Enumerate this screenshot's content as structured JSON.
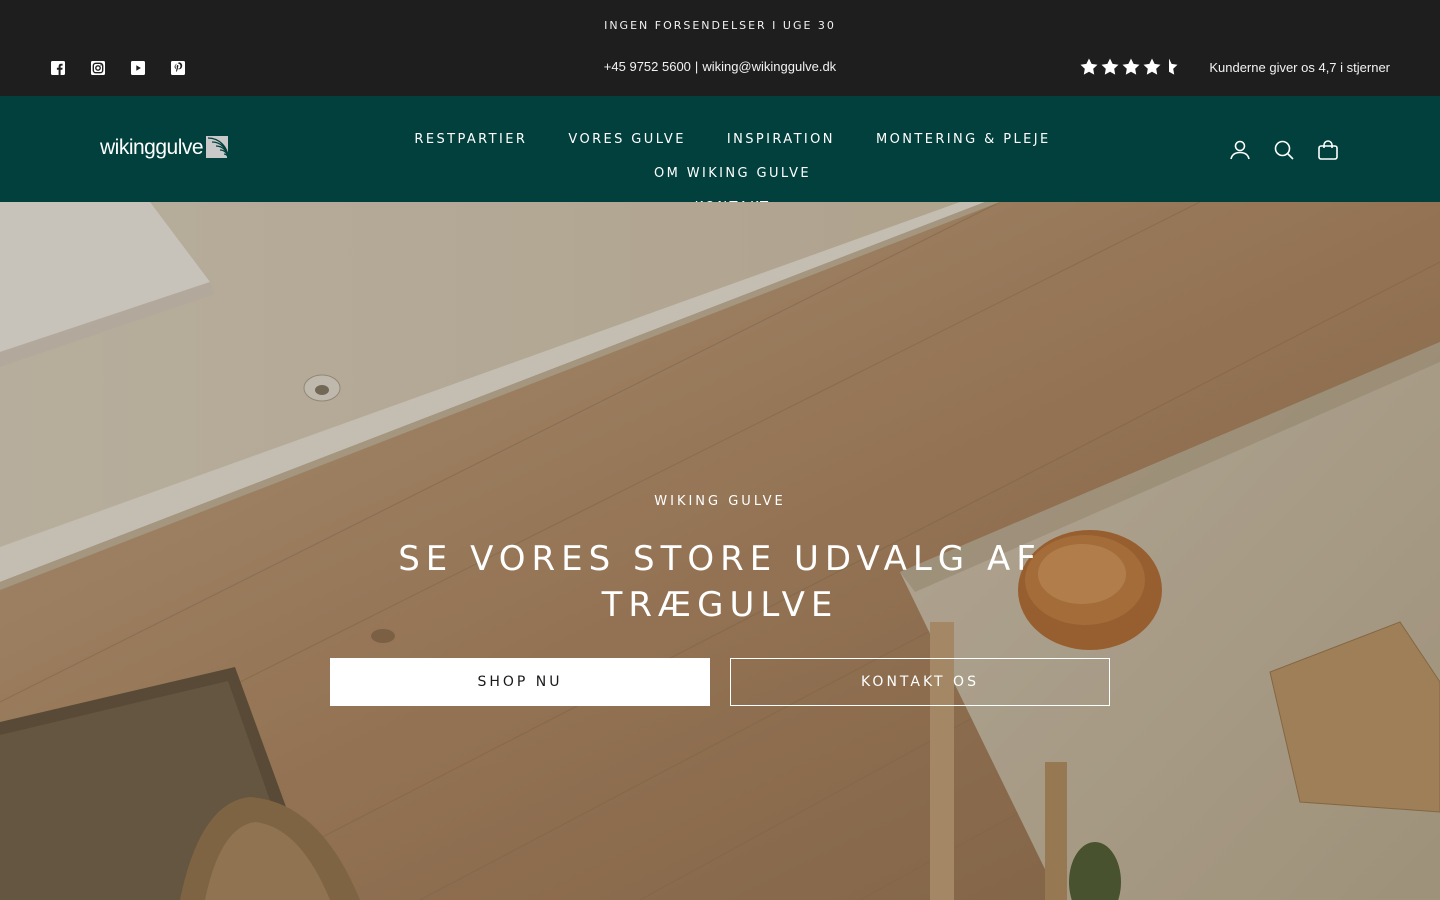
{
  "announcement": {
    "text": "INGEN FORSENDELSER I UGE 30"
  },
  "social": {
    "icons": [
      "facebook-icon",
      "instagram-icon",
      "youtube-icon",
      "pinterest-icon"
    ]
  },
  "contact": {
    "phone": "+45 9752 5600",
    "separator": "|",
    "email": "wiking@wikinggulve.dk"
  },
  "rating": {
    "stars": 4.7,
    "text": "Kunderne giver os 4,7 i stjerner"
  },
  "header": {
    "logo_text": "wikinggulve",
    "nav": {
      "item1": "RESTPARTIER",
      "item2": "VORES GULVE",
      "item3": "INSPIRATION",
      "item4": "MONTERING & PLEJE",
      "item5": "OM WIKING GULVE",
      "item6": "KONTAKT"
    },
    "icons": [
      "account-icon",
      "search-icon",
      "cart-icon"
    ]
  },
  "hero": {
    "subtitle": "WIKING GULVE",
    "title": "SE VORES STORE UDVALG AF TRÆGULVE",
    "primary_button": "SHOP NU",
    "secondary_button": "KONTAKT OS"
  },
  "colors": {
    "topbar_bg": "#1e1e1e",
    "header_bg": "#01403c",
    "text_light": "#ffffff"
  }
}
